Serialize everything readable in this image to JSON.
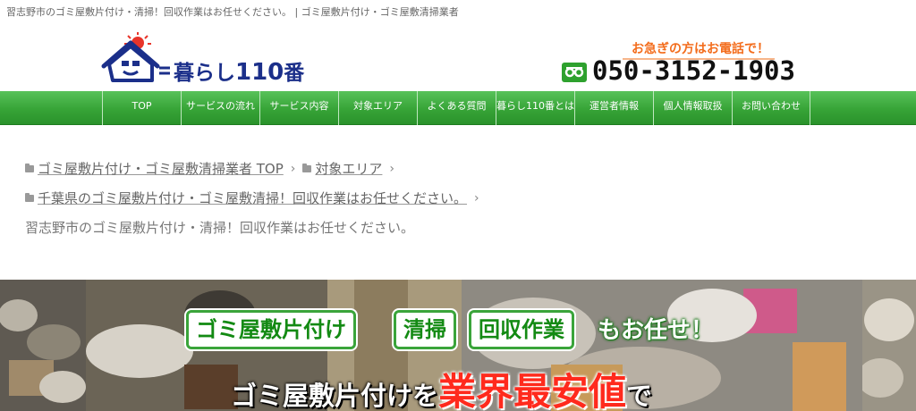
{
  "topbar": {
    "text": "習志野市のゴミ屋敷片付け・清掃！回収作業はお任せください。 | ゴミ屋敷片付け・ゴミ屋敷清掃業者"
  },
  "header": {
    "logo_text": "暮らし",
    "logo_num": "110",
    "logo_suffix": "番",
    "urgent_text": "お急ぎの方はお電話で！",
    "phone": "050-3152-1903",
    "colors": {
      "logo": "#1b2f8a",
      "accent": "#f36c1b",
      "freedial": "#2ea12e"
    }
  },
  "nav": {
    "items": [
      {
        "label": "TOP"
      },
      {
        "label": "サービスの流れ"
      },
      {
        "label": "サービス内容"
      },
      {
        "label": "対象エリア"
      },
      {
        "label": "よくある質問"
      },
      {
        "label": "暮らし110番とは"
      },
      {
        "label": "運営者情報"
      },
      {
        "label": "個人情報取扱"
      },
      {
        "label": "お問い合わせ"
      }
    ],
    "color": "#37a437"
  },
  "breadcrumb": {
    "items": [
      {
        "label": "ゴミ屋敷片付け・ゴミ屋敷清掃業者 TOP"
      },
      {
        "label": "対象エリア"
      },
      {
        "label": "千葉県のゴミ屋敷片付け・ゴミ屋敷清掃！回収作業はお任せください。"
      }
    ],
    "current": "習志野市のゴミ屋敷片付け・清掃！回収作業はお任せください。"
  },
  "banner": {
    "chips": [
      "ゴミ屋敷片付け",
      "清掃",
      "回収作業"
    ],
    "also": "もお任せ！",
    "headline_a": "ゴミ屋敷片付けを",
    "headline_b": "業界最安値",
    "headline_c": "で"
  }
}
